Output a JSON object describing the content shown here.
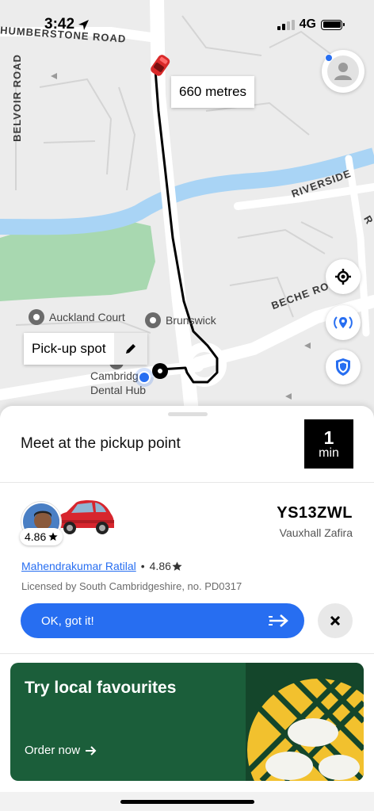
{
  "status_bar": {
    "time": "3:42",
    "network": "4G",
    "location_icon": "location-arrow-icon",
    "signal_bars": 4,
    "signal_bars_filled": 2
  },
  "map": {
    "streets": {
      "humberstone": "HUMBERSTONE ROAD",
      "belvoir": "BELVOIR ROAD",
      "riverside": "RIVERSIDE",
      "beche": "BECHE ROAD",
      "edge_letter": "R"
    },
    "pois": {
      "auckland": "Auckland Court",
      "brunswick": "Brunswick",
      "dental_line1": "Cambridge",
      "dental_line2": "Dental Hub"
    },
    "distance_label": "660 metres",
    "pickup_label": "Pick-up spot",
    "colors": {
      "background": "#ececec",
      "river": "#a9d4f5",
      "park": "#a8d8b0",
      "road": "#ffffff",
      "route": "#000000",
      "car": "#d92a2a"
    }
  },
  "sheet": {
    "title": "Meet at the pickup point",
    "eta_value": "1",
    "eta_unit": "min",
    "plate": "YS13ZWL",
    "car_model": "Vauxhall Zafira",
    "rating": "4.86",
    "driver_name": "Mahendrakumar Ratilal",
    "separator": "•",
    "driver_rating": "4.86",
    "license_text": "Licensed by South Cambridgeshire, no. PD0317",
    "ok_button": "OK, got it!",
    "accent_color": "#276ef1"
  },
  "promo": {
    "title": "Try local favourites",
    "cta": "Order now",
    "background": "#1b5e3a"
  }
}
